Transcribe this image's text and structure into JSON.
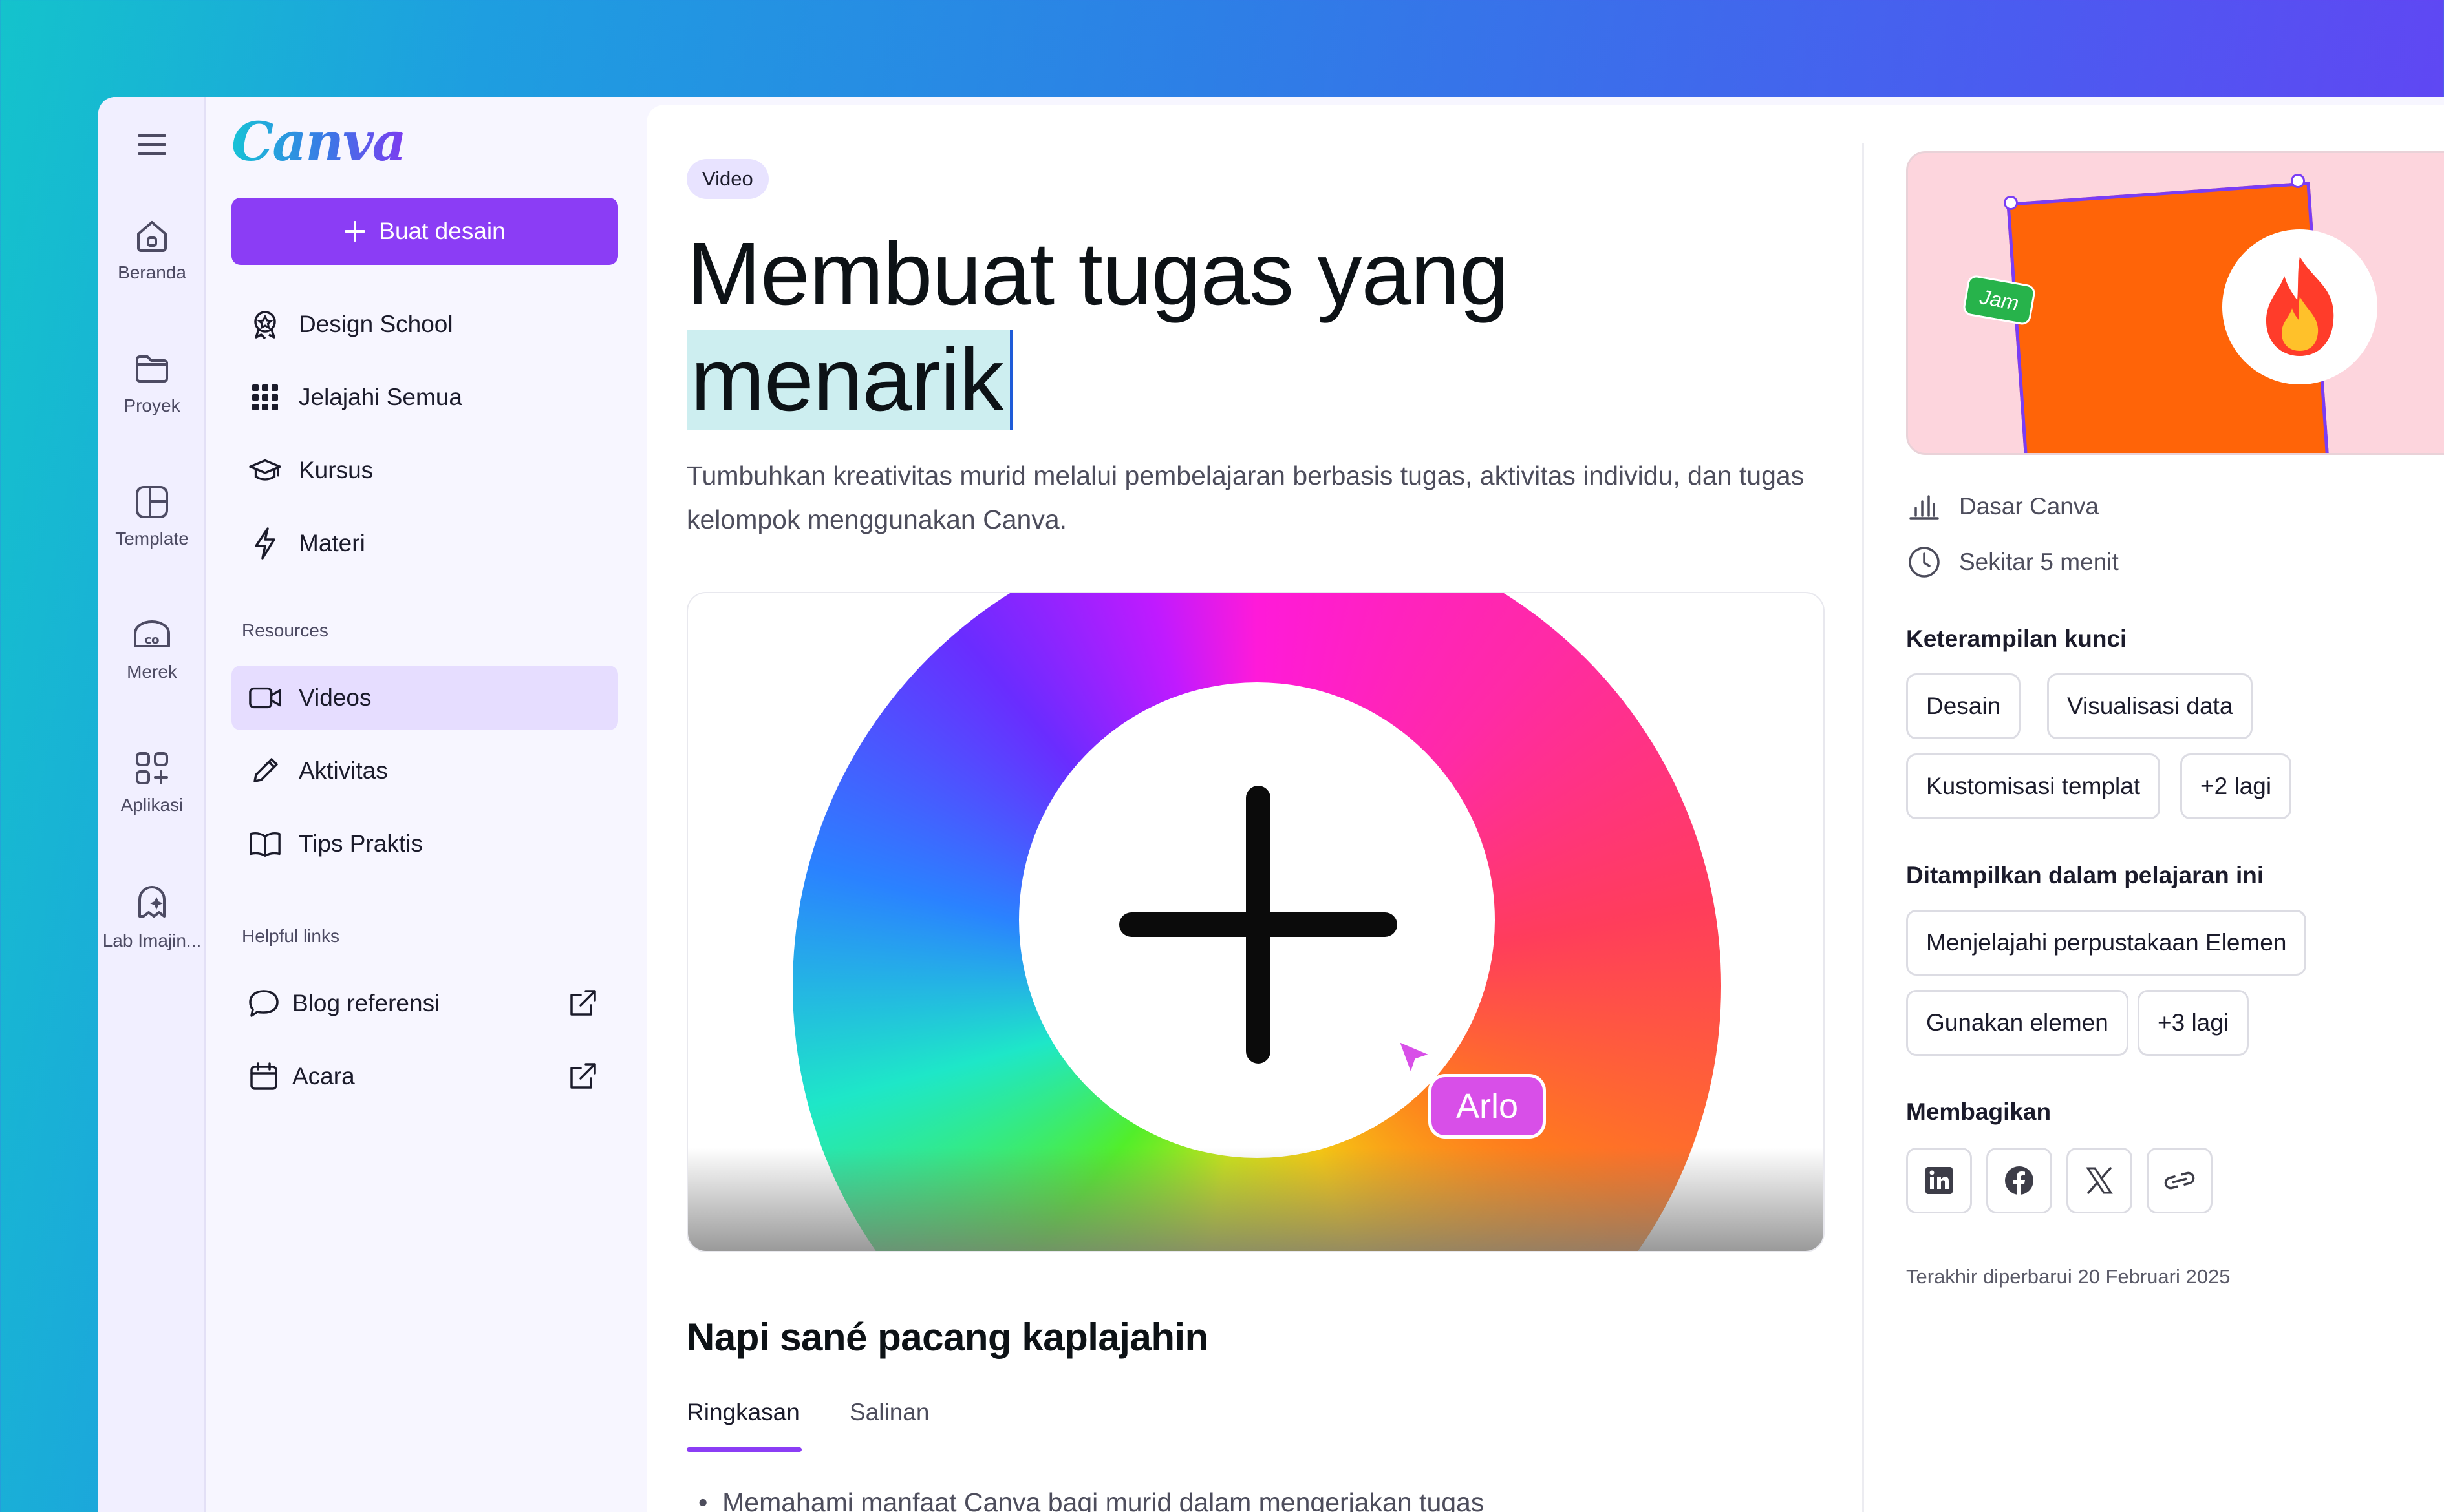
{
  "rail": {
    "items": [
      {
        "label": "Beranda",
        "icon": "home-icon"
      },
      {
        "label": "Proyek",
        "icon": "folder-icon"
      },
      {
        "label": "Template",
        "icon": "template-icon"
      },
      {
        "label": "Merek",
        "icon": "brand-icon"
      },
      {
        "label": "Aplikasi",
        "icon": "apps-icon"
      },
      {
        "label": "Lab Imajin...",
        "icon": "magic-lab-icon"
      }
    ]
  },
  "sidebar": {
    "logo": "Canva",
    "create_label": "Buat desain",
    "items": [
      {
        "label": "Design School"
      },
      {
        "label": "Jelajahi Semua"
      },
      {
        "label": "Kursus"
      },
      {
        "label": "Materi"
      }
    ],
    "resources_label": "Resources",
    "resources": [
      {
        "label": "Videos"
      },
      {
        "label": "Aktivitas"
      },
      {
        "label": "Tips Praktis"
      }
    ],
    "helpful_label": "Helpful links",
    "helpful": [
      {
        "label": "Blog referensi"
      },
      {
        "label": "Acara"
      }
    ]
  },
  "main": {
    "badge": "Video",
    "title_line1": "Membuat tugas yang",
    "title_line2": "menarik",
    "subtitle": "Tumbuhkan kreativitas murid melalui pembelajaran berbasis tugas, aktivitas individu, dan tugas kelompok menggunakan Canva.",
    "cursor_name": "Arlo",
    "section_title": "Napi sané pacang kaplajahin",
    "tabs": [
      {
        "label": "Ringkasan"
      },
      {
        "label": "Salinan"
      }
    ],
    "bullet": "Memahami manfaat Canva bagi murid dalam mengerjakan tugas"
  },
  "panel": {
    "thumb_tag": "Jam",
    "level": "Dasar Canva",
    "duration": "Sekitar 5 menit",
    "skills_heading": "Keterampilan kunci",
    "skills": [
      "Desain",
      "Visualisasi data",
      "Kustomisasi templat",
      "+2 lagi"
    ],
    "featured_heading": "Ditampilkan dalam pelajaran ini",
    "featured": [
      "Menjelajahi perpustakaan Elemen",
      "Gunakan elemen",
      "+3 lagi"
    ],
    "share_heading": "Membagikan",
    "updated": "Terakhir diperbarui 20 Februari 2025"
  },
  "colors": {
    "accent": "#8b3df5",
    "active_nav": "#e6ddff",
    "cursor_tag": "#d84fe8"
  }
}
